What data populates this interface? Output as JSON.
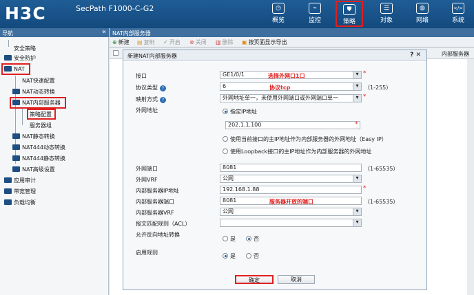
{
  "header": {
    "logo": "H3C",
    "product": "SecPath F1000-C-G2",
    "nav": [
      {
        "label": "概览",
        "icon": "dashboard-icon",
        "glyph": "◷"
      },
      {
        "label": "监控",
        "icon": "monitor-icon",
        "glyph": "⌁"
      },
      {
        "label": "策略",
        "icon": "shield-icon",
        "glyph": "⛊"
      },
      {
        "label": "对象",
        "icon": "list-icon",
        "glyph": "☰"
      },
      {
        "label": "网络",
        "icon": "internet-icon",
        "glyph": "◍"
      },
      {
        "label": "系统",
        "icon": "code-icon",
        "glyph": "</>"
      }
    ]
  },
  "sidebar": {
    "title": "导航",
    "collapse": "«",
    "items": [
      {
        "label": "安全策略"
      },
      {
        "label": "安全防护"
      },
      {
        "label": "NAT"
      },
      {
        "label": "NAT快速配置"
      },
      {
        "label": "NAT动态转换"
      },
      {
        "label": "NAT内部服务器"
      },
      {
        "label": "策略配置"
      },
      {
        "label": "服务器组"
      },
      {
        "label": "NAT静态转换"
      },
      {
        "label": "NAT444动态转换"
      },
      {
        "label": "NAT444静态转换"
      },
      {
        "label": "NAT高级设置"
      },
      {
        "label": "应用审计"
      },
      {
        "label": "带宽管理"
      },
      {
        "label": "负载均衡"
      }
    ]
  },
  "main": {
    "title": "NAT内部服务器",
    "toolbar": {
      "new": "新建",
      "copy": "复制",
      "enable": "开启",
      "disable": "关闭",
      "delete": "删除",
      "export": "按页面显示导出"
    },
    "column_right": "内部服务器"
  },
  "dialog": {
    "title": "新建NAT内部服务器",
    "ctrls": "? ✕",
    "labels": {
      "interface": "接口",
      "protocol": "协议类型",
      "mapping": "映射方式",
      "external": "外网地址",
      "ext_port": "外网端口",
      "ext_vrf": "外网VRF",
      "int_ip": "内部服务器IP地址",
      "int_port": "内部服务器端口",
      "int_vrf": "内部服务器VRF",
      "acl": "报文匹配规则（ACL）",
      "reverse": "允许反向地址转换",
      "enable_rule": "启用规则"
    },
    "values": {
      "interface": "GE1/0/1",
      "protocol": "6",
      "mapping": "外网地址单一，未使用外网端口或外网端口单一",
      "specified_ip": "指定IP地址",
      "ext_ip": "202.1.1.100",
      "easy_ip": "使用当前接口的主IP地址作为内部服务器的外网地址（Easy IP）",
      "loopback": "使用Loopback接口的主IP地址作为内部服务器的外网地址",
      "ext_port": "8081",
      "ext_vrf": "公网",
      "int_ip": "192.168.1.88",
      "int_port": "8081",
      "int_vrf": "公网",
      "acl": "",
      "yes": "是",
      "no": "否"
    },
    "ranges": {
      "protocol": "（1-255）",
      "ext_port": "（1-65535）",
      "int_port": "（1-65535）"
    },
    "annotations": {
      "interface": "选择外网口1口",
      "protocol": "协议tcp",
      "int_port": "服务器开放的端口"
    },
    "buttons": {
      "ok": "确定",
      "cancel": "取消"
    }
  },
  "colors": {
    "header": "#134a7d",
    "accent": "#e02020"
  }
}
